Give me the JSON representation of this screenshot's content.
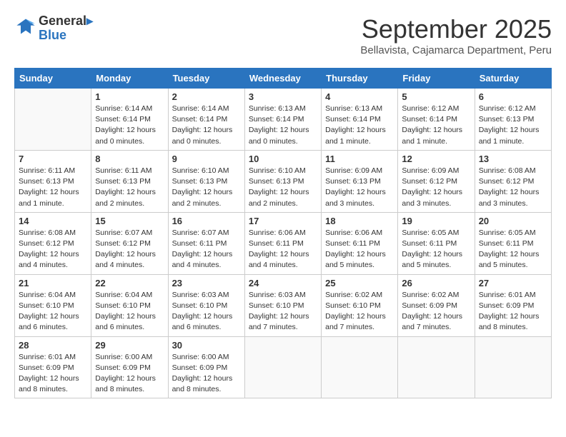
{
  "header": {
    "logo_line1": "General",
    "logo_line2": "Blue",
    "month_title": "September 2025",
    "subtitle": "Bellavista, Cajamarca Department, Peru"
  },
  "days_of_week": [
    "Sunday",
    "Monday",
    "Tuesday",
    "Wednesday",
    "Thursday",
    "Friday",
    "Saturday"
  ],
  "weeks": [
    [
      {
        "day": "",
        "info": ""
      },
      {
        "day": "1",
        "info": "Sunrise: 6:14 AM\nSunset: 6:14 PM\nDaylight: 12 hours\nand 0 minutes."
      },
      {
        "day": "2",
        "info": "Sunrise: 6:14 AM\nSunset: 6:14 PM\nDaylight: 12 hours\nand 0 minutes."
      },
      {
        "day": "3",
        "info": "Sunrise: 6:13 AM\nSunset: 6:14 PM\nDaylight: 12 hours\nand 0 minutes."
      },
      {
        "day": "4",
        "info": "Sunrise: 6:13 AM\nSunset: 6:14 PM\nDaylight: 12 hours\nand 1 minute."
      },
      {
        "day": "5",
        "info": "Sunrise: 6:12 AM\nSunset: 6:14 PM\nDaylight: 12 hours\nand 1 minute."
      },
      {
        "day": "6",
        "info": "Sunrise: 6:12 AM\nSunset: 6:13 PM\nDaylight: 12 hours\nand 1 minute."
      }
    ],
    [
      {
        "day": "7",
        "info": "Sunrise: 6:11 AM\nSunset: 6:13 PM\nDaylight: 12 hours\nand 1 minute."
      },
      {
        "day": "8",
        "info": "Sunrise: 6:11 AM\nSunset: 6:13 PM\nDaylight: 12 hours\nand 2 minutes."
      },
      {
        "day": "9",
        "info": "Sunrise: 6:10 AM\nSunset: 6:13 PM\nDaylight: 12 hours\nand 2 minutes."
      },
      {
        "day": "10",
        "info": "Sunrise: 6:10 AM\nSunset: 6:13 PM\nDaylight: 12 hours\nand 2 minutes."
      },
      {
        "day": "11",
        "info": "Sunrise: 6:09 AM\nSunset: 6:13 PM\nDaylight: 12 hours\nand 3 minutes."
      },
      {
        "day": "12",
        "info": "Sunrise: 6:09 AM\nSunset: 6:12 PM\nDaylight: 12 hours\nand 3 minutes."
      },
      {
        "day": "13",
        "info": "Sunrise: 6:08 AM\nSunset: 6:12 PM\nDaylight: 12 hours\nand 3 minutes."
      }
    ],
    [
      {
        "day": "14",
        "info": "Sunrise: 6:08 AM\nSunset: 6:12 PM\nDaylight: 12 hours\nand 4 minutes."
      },
      {
        "day": "15",
        "info": "Sunrise: 6:07 AM\nSunset: 6:12 PM\nDaylight: 12 hours\nand 4 minutes."
      },
      {
        "day": "16",
        "info": "Sunrise: 6:07 AM\nSunset: 6:11 PM\nDaylight: 12 hours\nand 4 minutes."
      },
      {
        "day": "17",
        "info": "Sunrise: 6:06 AM\nSunset: 6:11 PM\nDaylight: 12 hours\nand 4 minutes."
      },
      {
        "day": "18",
        "info": "Sunrise: 6:06 AM\nSunset: 6:11 PM\nDaylight: 12 hours\nand 5 minutes."
      },
      {
        "day": "19",
        "info": "Sunrise: 6:05 AM\nSunset: 6:11 PM\nDaylight: 12 hours\nand 5 minutes."
      },
      {
        "day": "20",
        "info": "Sunrise: 6:05 AM\nSunset: 6:11 PM\nDaylight: 12 hours\nand 5 minutes."
      }
    ],
    [
      {
        "day": "21",
        "info": "Sunrise: 6:04 AM\nSunset: 6:10 PM\nDaylight: 12 hours\nand 6 minutes."
      },
      {
        "day": "22",
        "info": "Sunrise: 6:04 AM\nSunset: 6:10 PM\nDaylight: 12 hours\nand 6 minutes."
      },
      {
        "day": "23",
        "info": "Sunrise: 6:03 AM\nSunset: 6:10 PM\nDaylight: 12 hours\nand 6 minutes."
      },
      {
        "day": "24",
        "info": "Sunrise: 6:03 AM\nSunset: 6:10 PM\nDaylight: 12 hours\nand 7 minutes."
      },
      {
        "day": "25",
        "info": "Sunrise: 6:02 AM\nSunset: 6:10 PM\nDaylight: 12 hours\nand 7 minutes."
      },
      {
        "day": "26",
        "info": "Sunrise: 6:02 AM\nSunset: 6:09 PM\nDaylight: 12 hours\nand 7 minutes."
      },
      {
        "day": "27",
        "info": "Sunrise: 6:01 AM\nSunset: 6:09 PM\nDaylight: 12 hours\nand 8 minutes."
      }
    ],
    [
      {
        "day": "28",
        "info": "Sunrise: 6:01 AM\nSunset: 6:09 PM\nDaylight: 12 hours\nand 8 minutes."
      },
      {
        "day": "29",
        "info": "Sunrise: 6:00 AM\nSunset: 6:09 PM\nDaylight: 12 hours\nand 8 minutes."
      },
      {
        "day": "30",
        "info": "Sunrise: 6:00 AM\nSunset: 6:09 PM\nDaylight: 12 hours\nand 8 minutes."
      },
      {
        "day": "",
        "info": ""
      },
      {
        "day": "",
        "info": ""
      },
      {
        "day": "",
        "info": ""
      },
      {
        "day": "",
        "info": ""
      }
    ]
  ]
}
